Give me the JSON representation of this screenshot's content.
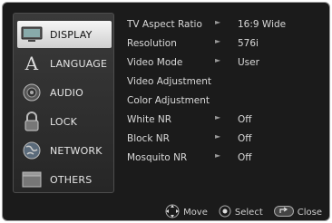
{
  "sidebar": {
    "items": [
      {
        "label": "DISPLAY",
        "icon": "monitor-icon",
        "selected": true
      },
      {
        "label": "LANGUAGE",
        "icon": "letter-a-icon",
        "selected": false
      },
      {
        "label": "AUDIO",
        "icon": "speaker-icon",
        "selected": false
      },
      {
        "label": "LOCK",
        "icon": "padlock-icon",
        "selected": false
      },
      {
        "label": "NETWORK",
        "icon": "globe-icon",
        "selected": false
      },
      {
        "label": "OTHERS",
        "icon": "box-icon",
        "selected": false
      }
    ]
  },
  "settings": {
    "rows": [
      {
        "label": "TV Aspect Ratio",
        "value": "16:9 Wide",
        "has_arrow": true
      },
      {
        "label": "Resolution",
        "value": "576i",
        "has_arrow": true
      },
      {
        "label": "Video Mode",
        "value": "User",
        "has_arrow": true
      },
      {
        "label": "Video Adjustment",
        "value": "",
        "has_arrow": false
      },
      {
        "label": "Color Adjustment",
        "value": "",
        "has_arrow": false
      },
      {
        "label": "White NR",
        "value": "Off",
        "has_arrow": true
      },
      {
        "label": "Block NR",
        "value": "Off",
        "has_arrow": true
      },
      {
        "label": "Mosquito NR",
        "value": "Off",
        "has_arrow": true
      }
    ],
    "arrow_glyph": "►"
  },
  "footer": {
    "hints": [
      {
        "label": "Move",
        "icon": "dpad-icon"
      },
      {
        "label": "Select",
        "icon": "enter-button-icon"
      },
      {
        "label": "Close",
        "icon": "return-button-icon"
      }
    ]
  }
}
